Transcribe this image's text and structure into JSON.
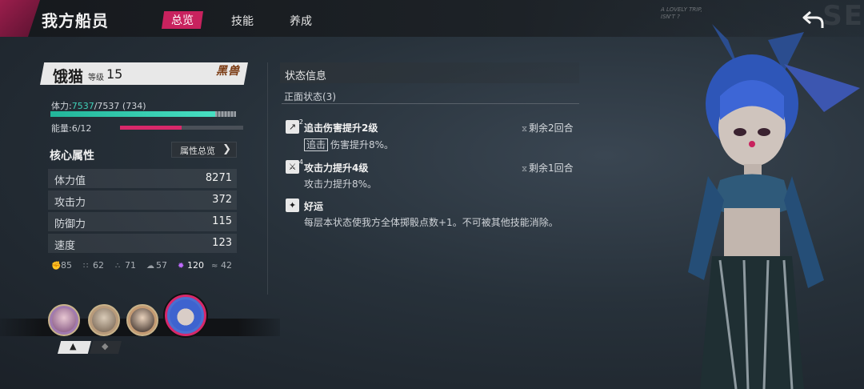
{
  "header": {
    "title": "我方船员",
    "tabs": [
      {
        "label": "总览",
        "active": true
      },
      {
        "label": "技能",
        "active": false
      },
      {
        "label": "养成",
        "active": false
      }
    ],
    "back_icon": "back-arrow-icon"
  },
  "background": {
    "handwriting": [
      "A LOVELY TRIP,",
      "ISN'T ?"
    ],
    "corner_text": "SE"
  },
  "character": {
    "name": "饿猫",
    "level_label": "等级",
    "level": "15",
    "tag": "黑兽",
    "hp_label": "体力:",
    "hp_current": "7537",
    "hp_rest": "/7537 (734)",
    "hp_fraction": 0.91,
    "energy_label": "能量:6/12",
    "energy_fraction": 0.5
  },
  "core_attributes": {
    "title": "核心属性",
    "overview_button": "属性总览",
    "stats": [
      {
        "label": "体力值",
        "value": "8271"
      },
      {
        "label": "攻击力",
        "value": "372"
      },
      {
        "label": "防御力",
        "value": "115"
      },
      {
        "label": "速度",
        "value": "123"
      }
    ],
    "mini_stats": [
      {
        "icon": "fist-icon",
        "value": "85"
      },
      {
        "icon": "boot-icon",
        "value": "62"
      },
      {
        "icon": "paw-icon",
        "value": "71"
      },
      {
        "icon": "cloud-icon",
        "value": "57"
      },
      {
        "icon": "burst-icon",
        "value": "120",
        "highlight": true
      },
      {
        "icon": "wing-icon",
        "value": "42"
      }
    ]
  },
  "status": {
    "title": "状态信息",
    "positive_label": "正面状态(3)",
    "buffs": [
      {
        "icon": "pursuit-buff-icon",
        "stack": "2",
        "name": "追击伤害提升2级",
        "tag": "追击",
        "desc": "伤害提升8%。",
        "turns": "剩余2回合"
      },
      {
        "icon": "sword-buff-icon",
        "stack": "4",
        "name": "攻击力提升4级",
        "tag": "",
        "desc": "攻击力提升8%。",
        "turns": "剩余1回合"
      },
      {
        "icon": "luck-buff-icon",
        "stack": "",
        "name": "好运",
        "tag": "",
        "desc": "每层本状态使我方全体掷骰点数+1。不可被其他技能消除。",
        "turns": ""
      }
    ]
  },
  "team": {
    "portraits": [
      {
        "name": "crew-portrait-1",
        "color": "#a07ab0"
      },
      {
        "name": "crew-portrait-2",
        "color": "#b89a7a"
      },
      {
        "name": "crew-portrait-3",
        "color": "#c49a72"
      },
      {
        "name": "crew-portrait-4",
        "color": "#4a6fd0",
        "selected": true
      }
    ]
  },
  "colors": {
    "accent": "#c8225e",
    "hp": "#2fc7ac",
    "energy": "#d8286a",
    "highlight_stat": "#c06bff"
  }
}
